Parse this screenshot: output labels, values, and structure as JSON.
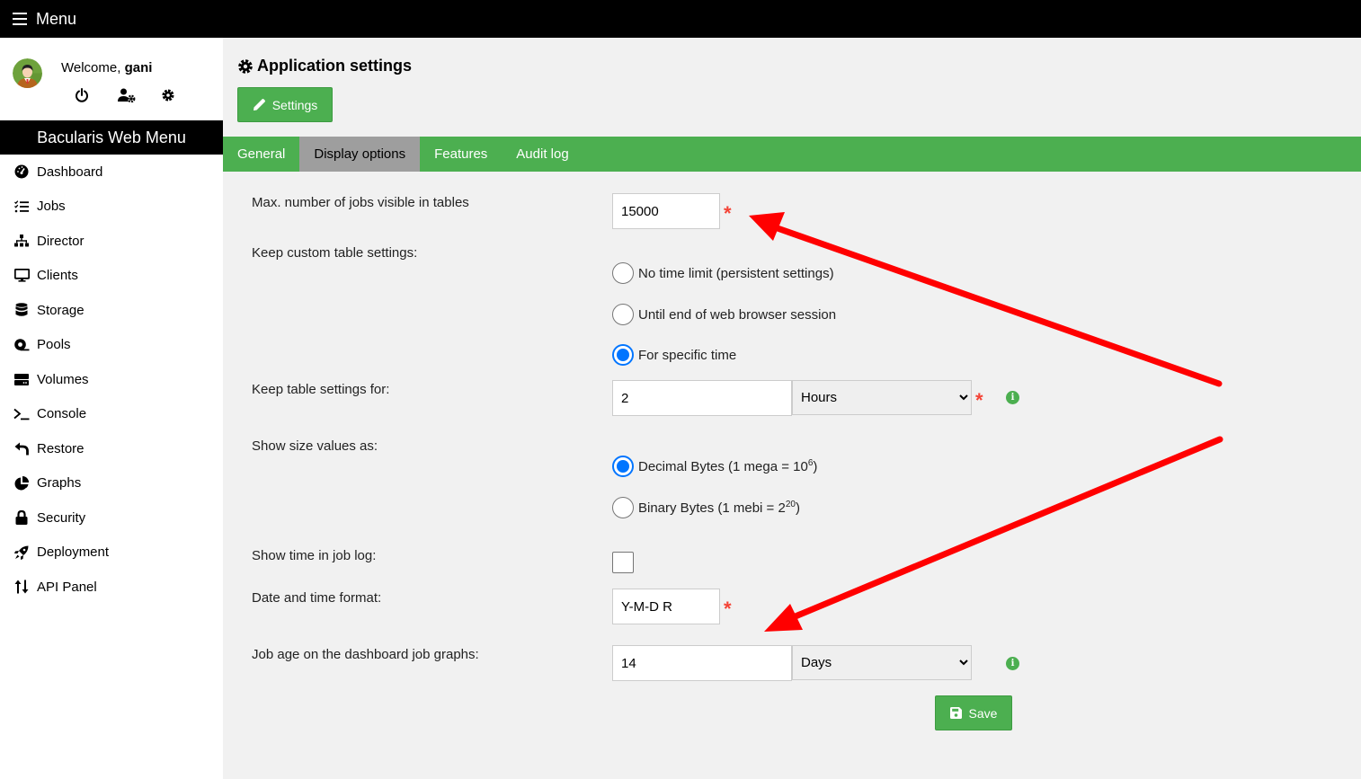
{
  "topbar": {
    "menu_label": "Menu"
  },
  "user": {
    "welcome_prefix": "Welcome, ",
    "username": "gani"
  },
  "sidebar": {
    "header": "Bacularis Web Menu",
    "items": [
      {
        "label": "Dashboard",
        "icon": "dashboard-icon"
      },
      {
        "label": "Jobs",
        "icon": "jobs-list-icon"
      },
      {
        "label": "Director",
        "icon": "sitemap-icon"
      },
      {
        "label": "Clients",
        "icon": "desktop-icon"
      },
      {
        "label": "Storage",
        "icon": "database-icon"
      },
      {
        "label": "Pools",
        "icon": "tape-icon"
      },
      {
        "label": "Volumes",
        "icon": "hdd-icon"
      },
      {
        "label": "Console",
        "icon": "terminal-icon"
      },
      {
        "label": "Restore",
        "icon": "undo-icon"
      },
      {
        "label": "Graphs",
        "icon": "pie-chart-icon"
      },
      {
        "label": "Security",
        "icon": "lock-icon"
      },
      {
        "label": "Deployment",
        "icon": "rocket-icon"
      },
      {
        "label": "API Panel",
        "icon": "sort-arrows-icon"
      }
    ]
  },
  "page": {
    "title": "Application settings",
    "settings_button": "Settings",
    "tabs": [
      {
        "label": "General",
        "active": false
      },
      {
        "label": "Display options",
        "active": true
      },
      {
        "label": "Features",
        "active": false
      },
      {
        "label": "Audit log",
        "active": false
      }
    ]
  },
  "form": {
    "max_jobs": {
      "label": "Max. number of jobs visible in tables",
      "value": "15000",
      "required": "*"
    },
    "keep_custom": {
      "label": "Keep custom table settings:",
      "options": [
        {
          "label": "No time limit (persistent settings)",
          "checked": false
        },
        {
          "label": "Until end of web browser session",
          "checked": false
        },
        {
          "label": "For specific time",
          "checked": true
        }
      ]
    },
    "keep_for": {
      "label": "Keep table settings for:",
      "value": "2",
      "unit": "Hours",
      "required": "*",
      "info": "i"
    },
    "size_values": {
      "label": "Show size values as:",
      "options": [
        {
          "label": "Decimal Bytes (1 mega = 10",
          "sup": "6",
          "suffix": ")",
          "checked": true
        },
        {
          "label": "Binary Bytes (1 mebi = 2",
          "sup": "20",
          "suffix": ")",
          "checked": false
        }
      ]
    },
    "show_time": {
      "label": "Show time in job log:",
      "checked": false
    },
    "date_format": {
      "label": "Date and time format:",
      "value": "Y-M-D R",
      "required": "*"
    },
    "job_age": {
      "label": "Job age on the dashboard job graphs:",
      "value": "14",
      "unit": "Days",
      "info": "i"
    },
    "save_button": "Save"
  },
  "annotation": {
    "arrow_color": "#ff0000"
  },
  "colors": {
    "accent": "#4caf50",
    "active_tab": "#9e9e9e",
    "required": "#f44336",
    "radio_checked": "#0075ff"
  }
}
